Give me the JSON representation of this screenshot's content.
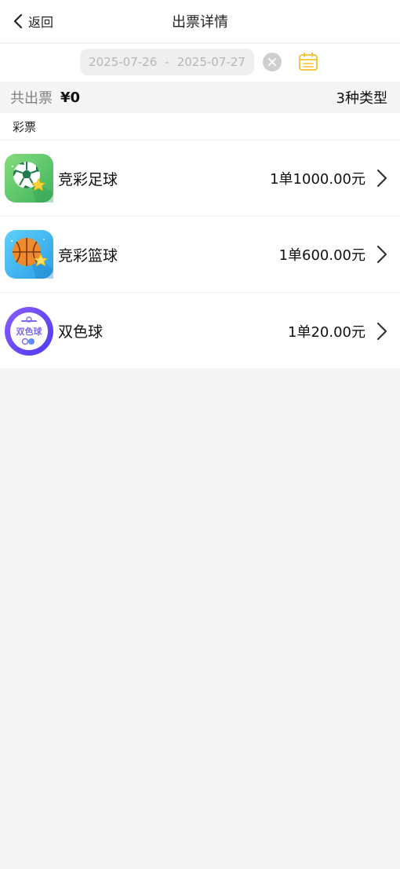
{
  "nav": {
    "back_label": "返回",
    "title": "出票详情"
  },
  "date_range": {
    "start": "2025-07-26",
    "separator": "-",
    "end": "2025-07-27"
  },
  "summary": {
    "label": "共出票",
    "amount": "¥0",
    "types": "3种类型"
  },
  "section": {
    "title": "彩票"
  },
  "items": [
    {
      "name": "竞彩足球",
      "amount": "1单1000.00元",
      "icon": "soccer-ball-icon"
    },
    {
      "name": "竞彩篮球",
      "amount": "1单600.00元",
      "icon": "basketball-icon"
    },
    {
      "name": "双色球",
      "amount": "1单20.00元",
      "icon": "double-color-ball-icon",
      "icon_text": "双色球"
    }
  ],
  "colors": {
    "calendar": "#f5c12e",
    "soccer_bg": "#5fc86e",
    "basketball_bg": "#3fb8ee",
    "ssq_bg": "#6a4cf5"
  }
}
